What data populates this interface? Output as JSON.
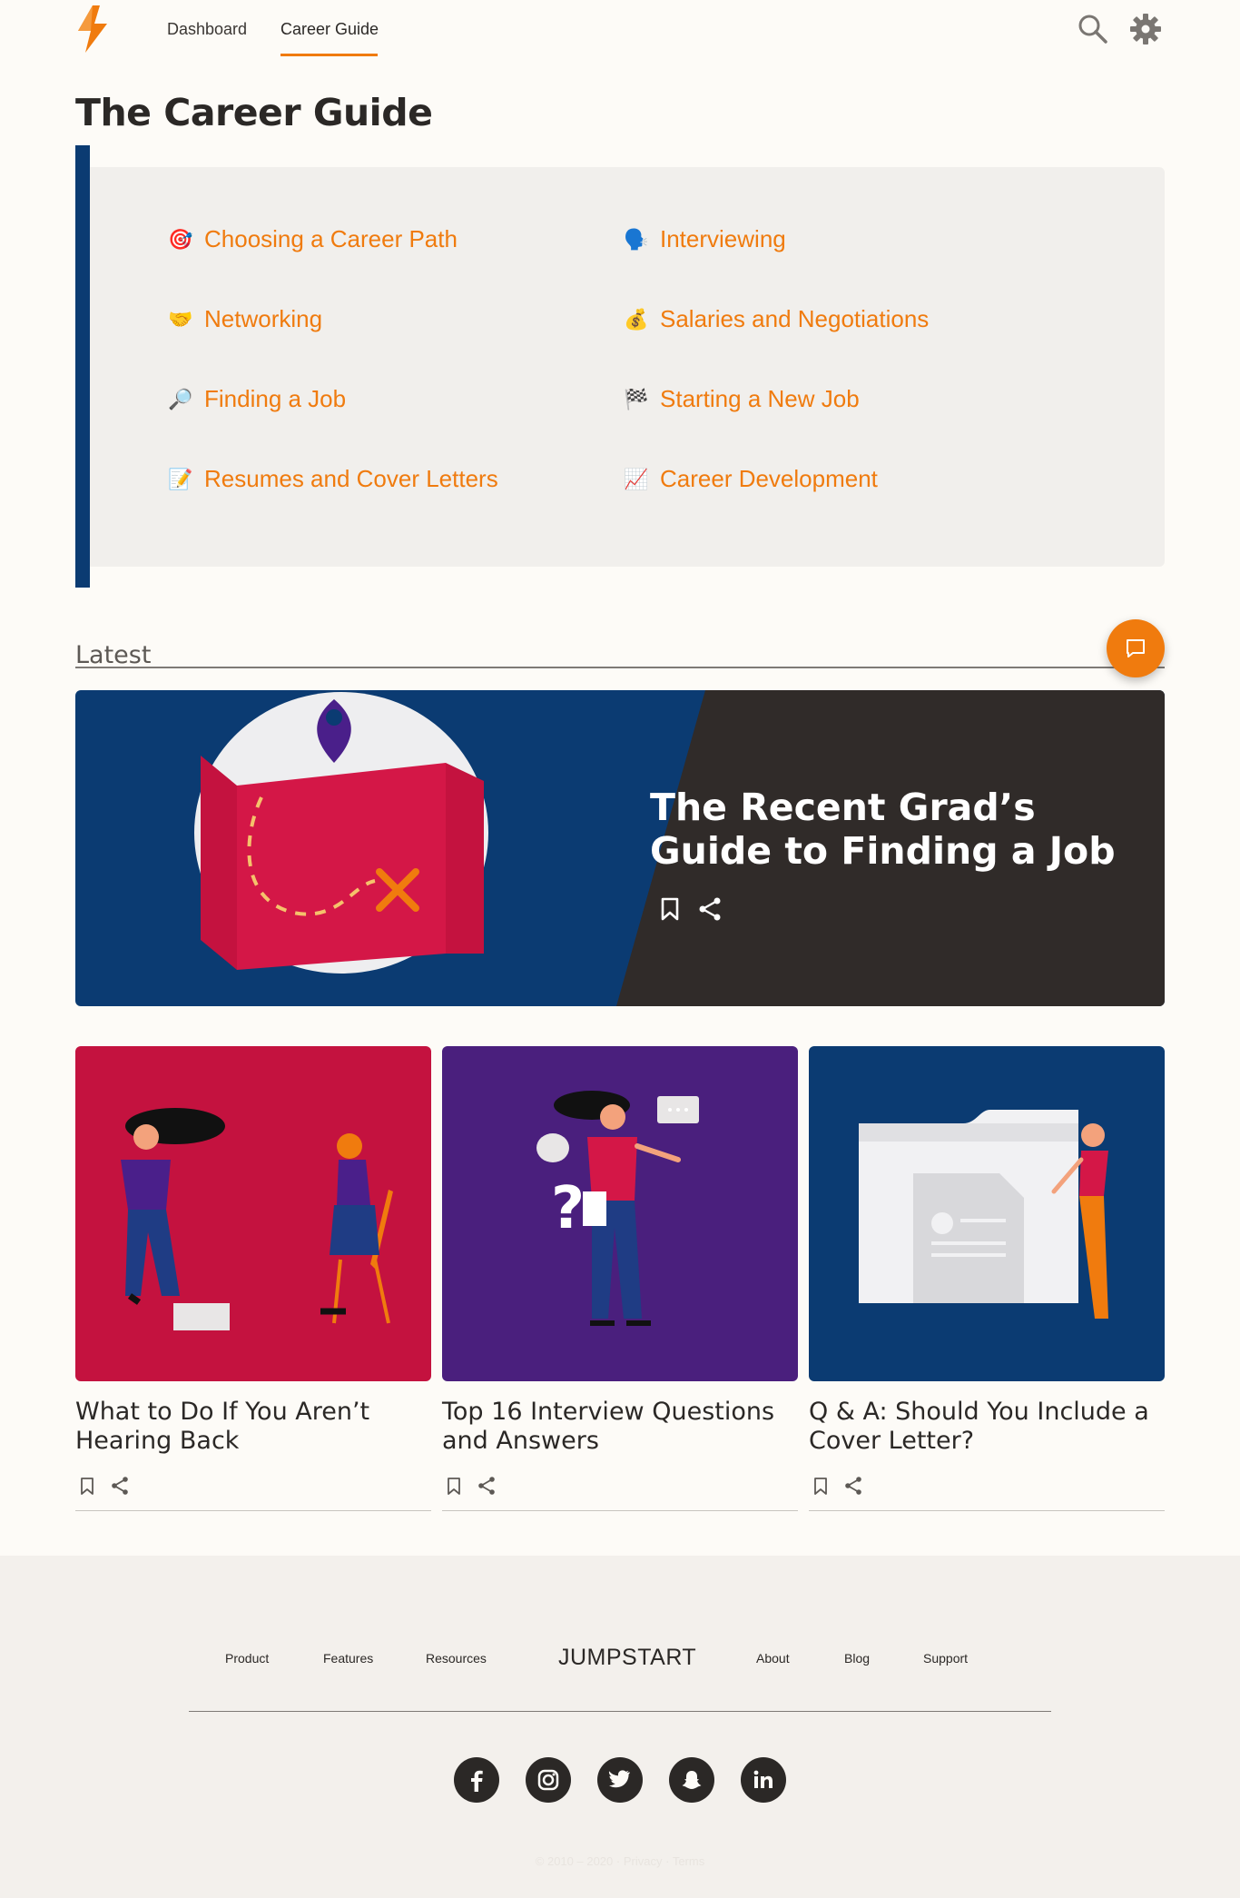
{
  "header": {
    "nav": [
      {
        "label": "Dashboard"
      },
      {
        "label": "Career Guide"
      }
    ],
    "active_tab": "Career Guide",
    "accent_color": "#f07b0e",
    "icons": [
      "search-icon",
      "gear-icon"
    ]
  },
  "page": {
    "title": "The Career Guide"
  },
  "topics": [
    {
      "label": "Choosing a Career Path",
      "emoji": "🎯"
    },
    {
      "label": "Interviewing",
      "emoji": "🗣️"
    },
    {
      "label": "Networking",
      "emoji": "🤝"
    },
    {
      "label": "Salaries and Negotiations",
      "emoji": "💰"
    },
    {
      "label": "Finding a Job",
      "emoji": "🔎"
    },
    {
      "label": "Starting a New Job",
      "emoji": "🏁"
    },
    {
      "label": "Resumes and Cover Letters",
      "emoji": "📝"
    },
    {
      "label": "Career Development",
      "emoji": "📈"
    }
  ],
  "latest": {
    "label": "Latest",
    "hero": {
      "title": "The Recent Grad’s Guide to Finding a Job"
    },
    "cards": [
      {
        "title": "What to Do If You Aren’t Hearing Back"
      },
      {
        "title": "Top 16 Interview Questions and Answers"
      },
      {
        "title": "Q & A: Should You Include a Cover Letter?"
      }
    ]
  },
  "footer": {
    "links_left": [
      "Product",
      "Features",
      "Resources"
    ],
    "brand": "JUMPSTART",
    "links_right": [
      "About",
      "Blog",
      "Support"
    ],
    "social": [
      "facebook-icon",
      "instagram-icon",
      "twitter-icon",
      "snapchat-icon",
      "linkedin-icon"
    ],
    "copyright": "© 2010 – 2020",
    "privacy": "Privacy",
    "terms": "Terms"
  },
  "colors": {
    "brand_orange": "#f07b0e",
    "navy": "#0b3b72",
    "dark": "#2b2826"
  }
}
